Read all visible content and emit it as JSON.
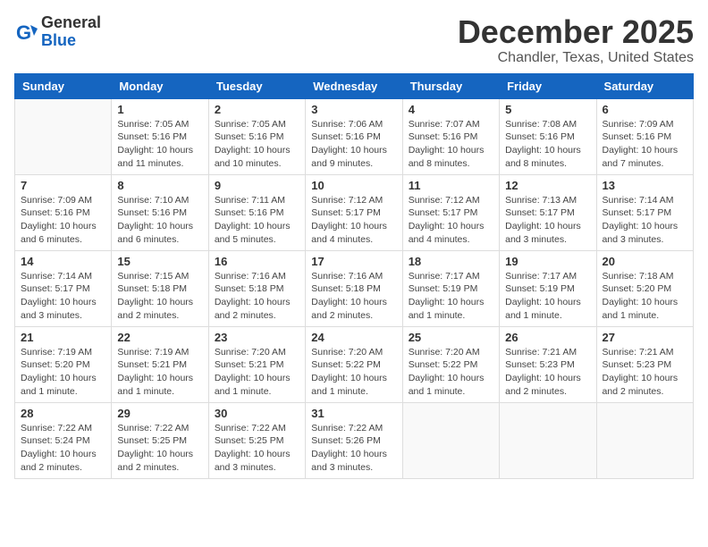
{
  "header": {
    "logo_general": "General",
    "logo_blue": "Blue",
    "month_title": "December 2025",
    "location": "Chandler, Texas, United States"
  },
  "days_of_week": [
    "Sunday",
    "Monday",
    "Tuesday",
    "Wednesday",
    "Thursday",
    "Friday",
    "Saturday"
  ],
  "weeks": [
    [
      {
        "day": "",
        "info": ""
      },
      {
        "day": "1",
        "info": "Sunrise: 7:05 AM\nSunset: 5:16 PM\nDaylight: 10 hours\nand 11 minutes."
      },
      {
        "day": "2",
        "info": "Sunrise: 7:05 AM\nSunset: 5:16 PM\nDaylight: 10 hours\nand 10 minutes."
      },
      {
        "day": "3",
        "info": "Sunrise: 7:06 AM\nSunset: 5:16 PM\nDaylight: 10 hours\nand 9 minutes."
      },
      {
        "day": "4",
        "info": "Sunrise: 7:07 AM\nSunset: 5:16 PM\nDaylight: 10 hours\nand 8 minutes."
      },
      {
        "day": "5",
        "info": "Sunrise: 7:08 AM\nSunset: 5:16 PM\nDaylight: 10 hours\nand 8 minutes."
      },
      {
        "day": "6",
        "info": "Sunrise: 7:09 AM\nSunset: 5:16 PM\nDaylight: 10 hours\nand 7 minutes."
      }
    ],
    [
      {
        "day": "7",
        "info": "Sunrise: 7:09 AM\nSunset: 5:16 PM\nDaylight: 10 hours\nand 6 minutes."
      },
      {
        "day": "8",
        "info": "Sunrise: 7:10 AM\nSunset: 5:16 PM\nDaylight: 10 hours\nand 6 minutes."
      },
      {
        "day": "9",
        "info": "Sunrise: 7:11 AM\nSunset: 5:16 PM\nDaylight: 10 hours\nand 5 minutes."
      },
      {
        "day": "10",
        "info": "Sunrise: 7:12 AM\nSunset: 5:17 PM\nDaylight: 10 hours\nand 4 minutes."
      },
      {
        "day": "11",
        "info": "Sunrise: 7:12 AM\nSunset: 5:17 PM\nDaylight: 10 hours\nand 4 minutes."
      },
      {
        "day": "12",
        "info": "Sunrise: 7:13 AM\nSunset: 5:17 PM\nDaylight: 10 hours\nand 3 minutes."
      },
      {
        "day": "13",
        "info": "Sunrise: 7:14 AM\nSunset: 5:17 PM\nDaylight: 10 hours\nand 3 minutes."
      }
    ],
    [
      {
        "day": "14",
        "info": "Sunrise: 7:14 AM\nSunset: 5:17 PM\nDaylight: 10 hours\nand 3 minutes."
      },
      {
        "day": "15",
        "info": "Sunrise: 7:15 AM\nSunset: 5:18 PM\nDaylight: 10 hours\nand 2 minutes."
      },
      {
        "day": "16",
        "info": "Sunrise: 7:16 AM\nSunset: 5:18 PM\nDaylight: 10 hours\nand 2 minutes."
      },
      {
        "day": "17",
        "info": "Sunrise: 7:16 AM\nSunset: 5:18 PM\nDaylight: 10 hours\nand 2 minutes."
      },
      {
        "day": "18",
        "info": "Sunrise: 7:17 AM\nSunset: 5:19 PM\nDaylight: 10 hours\nand 1 minute."
      },
      {
        "day": "19",
        "info": "Sunrise: 7:17 AM\nSunset: 5:19 PM\nDaylight: 10 hours\nand 1 minute."
      },
      {
        "day": "20",
        "info": "Sunrise: 7:18 AM\nSunset: 5:20 PM\nDaylight: 10 hours\nand 1 minute."
      }
    ],
    [
      {
        "day": "21",
        "info": "Sunrise: 7:19 AM\nSunset: 5:20 PM\nDaylight: 10 hours\nand 1 minute."
      },
      {
        "day": "22",
        "info": "Sunrise: 7:19 AM\nSunset: 5:21 PM\nDaylight: 10 hours\nand 1 minute."
      },
      {
        "day": "23",
        "info": "Sunrise: 7:20 AM\nSunset: 5:21 PM\nDaylight: 10 hours\nand 1 minute."
      },
      {
        "day": "24",
        "info": "Sunrise: 7:20 AM\nSunset: 5:22 PM\nDaylight: 10 hours\nand 1 minute."
      },
      {
        "day": "25",
        "info": "Sunrise: 7:20 AM\nSunset: 5:22 PM\nDaylight: 10 hours\nand 1 minute."
      },
      {
        "day": "26",
        "info": "Sunrise: 7:21 AM\nSunset: 5:23 PM\nDaylight: 10 hours\nand 2 minutes."
      },
      {
        "day": "27",
        "info": "Sunrise: 7:21 AM\nSunset: 5:23 PM\nDaylight: 10 hours\nand 2 minutes."
      }
    ],
    [
      {
        "day": "28",
        "info": "Sunrise: 7:22 AM\nSunset: 5:24 PM\nDaylight: 10 hours\nand 2 minutes."
      },
      {
        "day": "29",
        "info": "Sunrise: 7:22 AM\nSunset: 5:25 PM\nDaylight: 10 hours\nand 2 minutes."
      },
      {
        "day": "30",
        "info": "Sunrise: 7:22 AM\nSunset: 5:25 PM\nDaylight: 10 hours\nand 3 minutes."
      },
      {
        "day": "31",
        "info": "Sunrise: 7:22 AM\nSunset: 5:26 PM\nDaylight: 10 hours\nand 3 minutes."
      },
      {
        "day": "",
        "info": ""
      },
      {
        "day": "",
        "info": ""
      },
      {
        "day": "",
        "info": ""
      }
    ]
  ]
}
